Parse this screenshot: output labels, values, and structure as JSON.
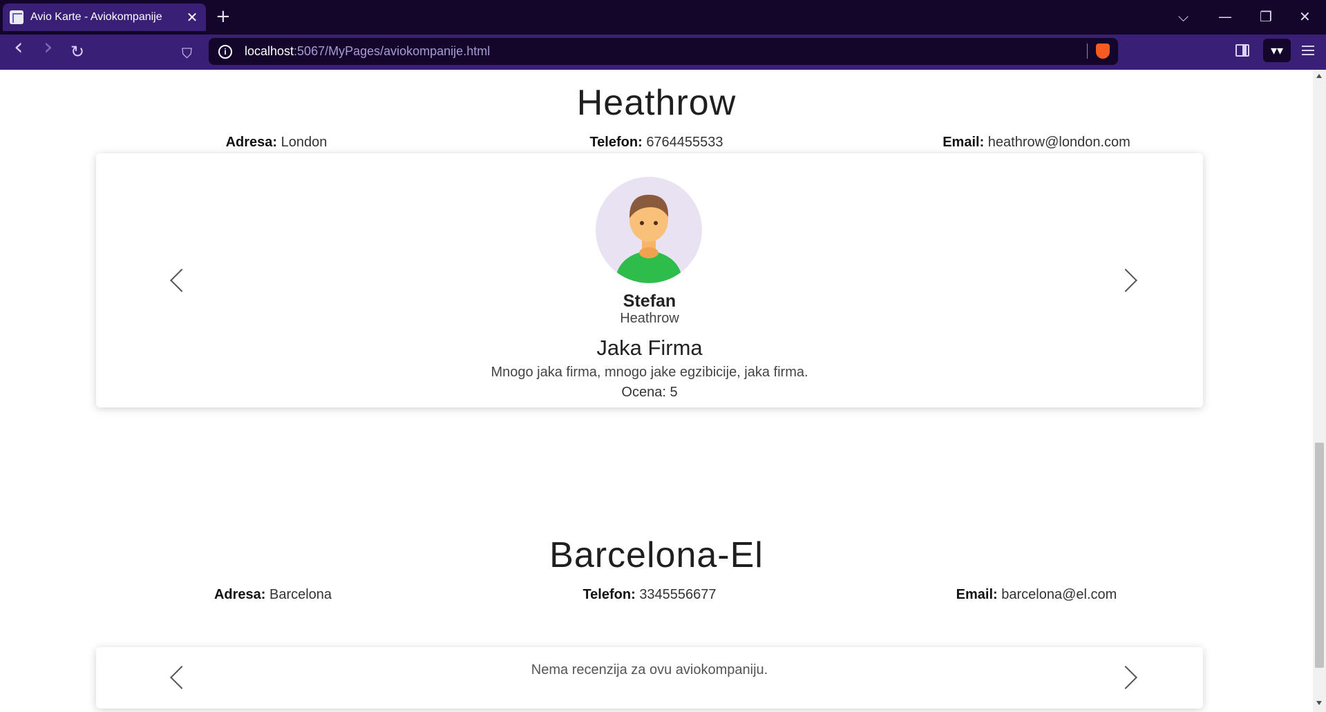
{
  "browser": {
    "tab_title": "Avio Karte - Aviokompanije",
    "tab_close": "✕",
    "new_tab": "+",
    "url_host": "localhost",
    "url_path": ":5067/MyPages/aviokompanije.html",
    "win_min": "—",
    "win_restore": "❐",
    "win_close": "✕",
    "tab_list": "⌵",
    "back": "‹",
    "forward": "›",
    "reload": "↻",
    "bookmark": "⛉",
    "wallet": "▾▾",
    "info": "i"
  },
  "airlines": [
    {
      "name": "Heathrow",
      "adresa_label": "Adresa:",
      "adresa": "London",
      "telefon_label": "Telefon:",
      "telefon": "6764455533",
      "email_label": "Email:",
      "email": "heathrow@london.com",
      "review": {
        "reviewer": "Stefan",
        "airline": "Heathrow",
        "title": "Jaka Firma",
        "text": "Mnogo jaka firma, mnogo jake egzibicije, jaka firma.",
        "rating": "Ocena: 5"
      }
    },
    {
      "name": "Barcelona-El",
      "adresa_label": "Adresa:",
      "adresa": "Barcelona",
      "telefon_label": "Telefon:",
      "telefon": "3345556677",
      "email_label": "Email:",
      "email": "barcelona@el.com",
      "no_reviews": "Nema recenzija za ovu aviokompaniju."
    }
  ],
  "colors": {
    "tabbar_bg": "#14052a",
    "navbar_bg": "#3a1f76",
    "avatar_bg": "#e8e2f2",
    "avatar_shirt": "#2ebd4b",
    "avatar_skin": "#f7b56b",
    "avatar_hair": "#8a5a3c"
  }
}
